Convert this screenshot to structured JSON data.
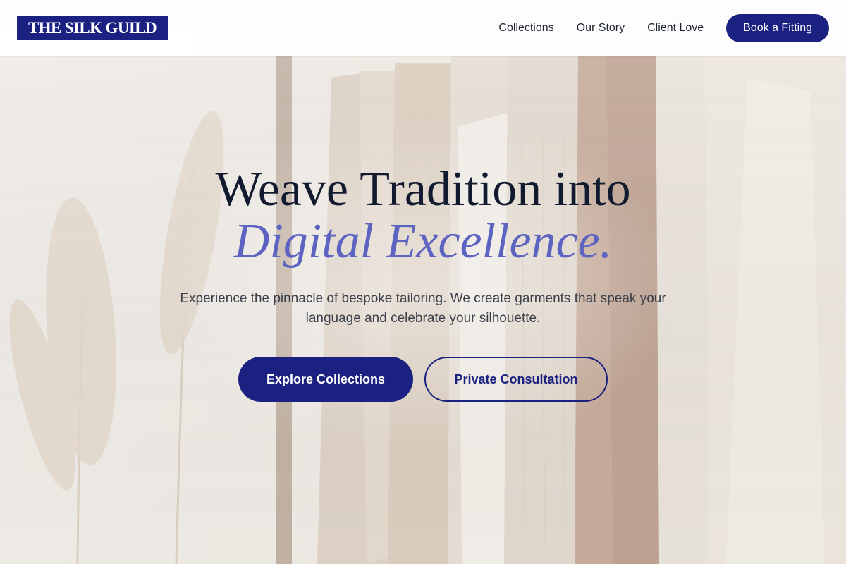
{
  "brand": {
    "name": "THE SILK GUILD"
  },
  "nav": {
    "links": [
      "Collections",
      "Our Story",
      "Client Love"
    ],
    "cta": "Book a Fitting"
  },
  "hero": {
    "title_line1": "Weave Tradition into",
    "title_line2": "Digital Excellence.",
    "subtitle": "Experience the pinnacle of bespoke tailoring. We create garments that speak your language and celebrate your silhouette.",
    "primary_button": "Explore Collections",
    "secondary_button": "Private Consultation",
    "background_image": "clothing-rack-photo"
  },
  "colors": {
    "brand_navy": "#1b2180",
    "accent_periwinkle": "#5c63c0",
    "title_dark": "#111a2e"
  }
}
